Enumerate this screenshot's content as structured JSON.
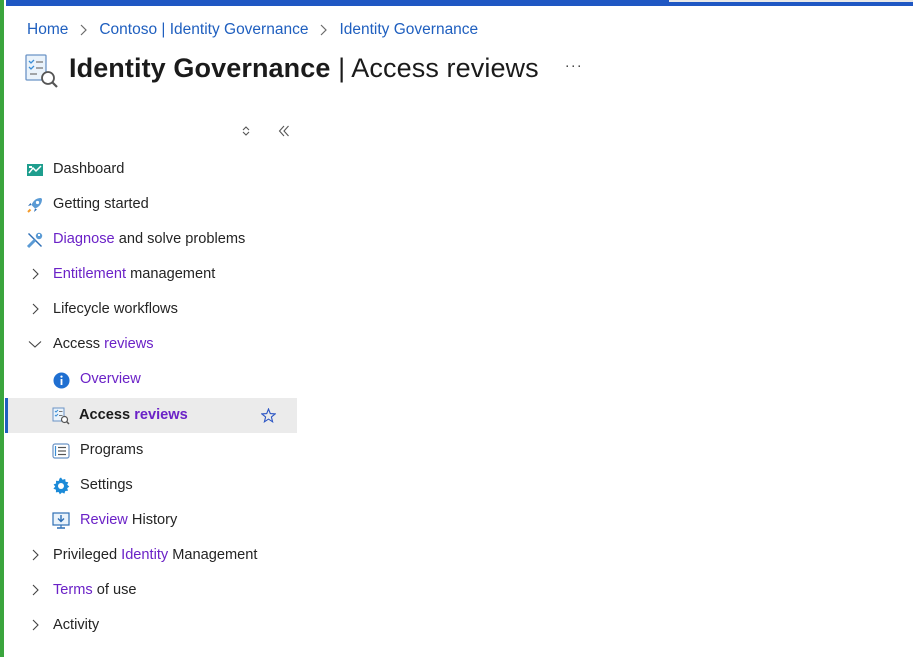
{
  "breadcrumb": {
    "items": [
      "Home",
      "Contoso | Identity Governance",
      "Identity Governance"
    ]
  },
  "header": {
    "title_bold": "Identity Governance",
    "title_rest": " | Access reviews",
    "more_label": "···"
  },
  "nav": {
    "dashboard": "Dashboard",
    "getting_started": "Getting started",
    "diagnose_a": "Diagnose",
    "diagnose_b": " and solve problems",
    "entitlement_a": "Entitlement",
    "entitlement_b": " management",
    "lifecycle": "Lifecycle workflows",
    "access_reviews_a": "Access ",
    "access_reviews_b": "reviews",
    "overview": "Overview",
    "access_reviews_sub_a": "Access ",
    "access_reviews_sub_b": "reviews",
    "programs": "Programs",
    "settings": "Settings",
    "review_history_a": "Review",
    "review_history_b": " History",
    "pim_a": "Privileged ",
    "pim_b": "Identity",
    "pim_c": " Management",
    "terms_a": "Terms",
    "terms_b": " of use",
    "activity": "Activity"
  },
  "colors": {
    "link": "#1f5fbf",
    "highlight": "#6b22c7",
    "active_bg": "#ebebeb",
    "top_bar": "#1f57c3",
    "left_edge": "#3aa53d"
  },
  "icons": {
    "page": "access-reviews-icon",
    "sort": "sort-updown-icon",
    "collapse": "double-chevron-left-icon",
    "favorite": "star-icon"
  }
}
